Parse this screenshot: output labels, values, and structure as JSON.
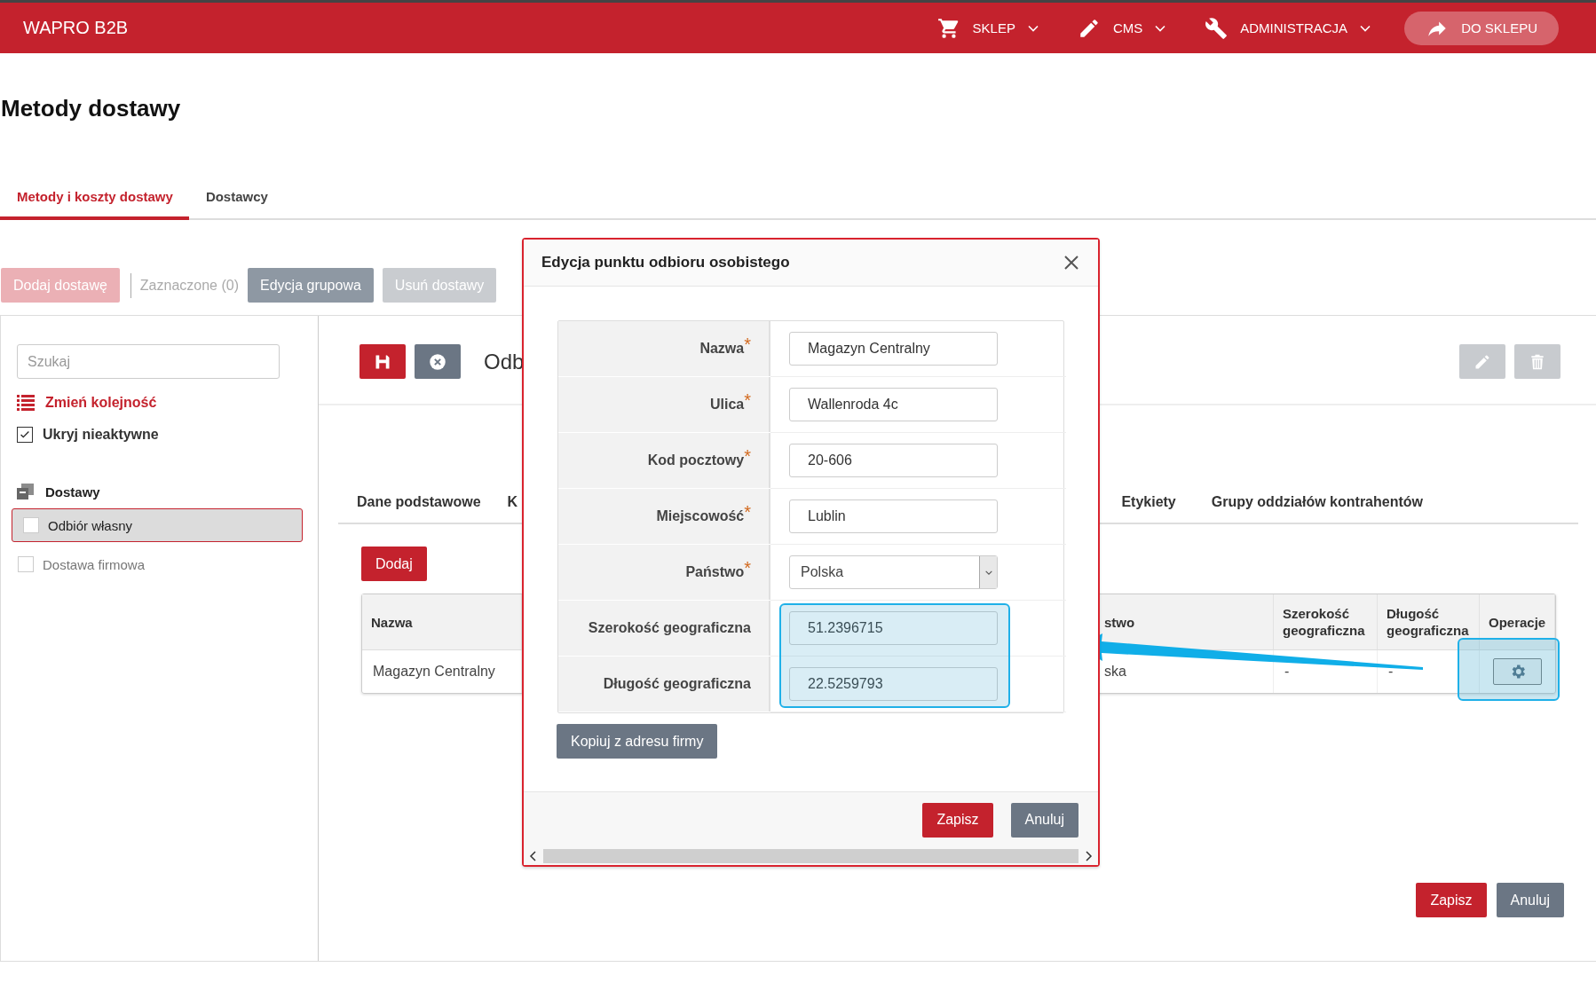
{
  "app": {
    "logo": "WAPRO B2B"
  },
  "nav": [
    {
      "label": "SKLEP",
      "kind": "cart"
    },
    {
      "label": "CMS",
      "kind": "pencil"
    },
    {
      "label": "ADMINISTRACJA",
      "kind": "wrench"
    }
  ],
  "shop_button": {
    "label": "DO SKLEPU"
  },
  "page_title": "Metody dostawy",
  "tabs": [
    {
      "label": "Metody i koszty dostawy",
      "selected": true
    },
    {
      "label": "Dostawcy",
      "selected": false
    }
  ],
  "toolbar": {
    "add_button": {
      "label": "Dodaj dostawę",
      "disabled": true
    },
    "selection_label": "Zaznaczone (0)",
    "buttons": [
      {
        "label": "Edycja grupowa",
        "disabled": false
      },
      {
        "label": "Usuń dostawy",
        "disabled": true
      }
    ]
  },
  "sidebar": {
    "search": {
      "placeholder": "Szukaj"
    },
    "reorder_link": "Zmień kolejność",
    "hide_inactive": {
      "label": "Ukryj nieaktywne",
      "checked": true
    },
    "group": "Dostawy",
    "items": [
      {
        "label": "Odbiór własny",
        "selected": true,
        "checked": false
      },
      {
        "label": "Dostawa firmowa",
        "selected": false,
        "checked": false
      }
    ]
  },
  "detail": {
    "title": "Odb",
    "subtabs": [
      {
        "label": "Dane podstawowe",
        "selected": false
      },
      {
        "label": "K",
        "selected": false
      },
      {
        "label": "Etykiety",
        "selected": false
      },
      {
        "label": "Grupy oddziałów kontrahentów",
        "selected": false
      }
    ],
    "add_button": "Dodaj",
    "table": {
      "columns": [
        "Nazwa",
        "stwo",
        "Szerokość geograficzna",
        "Długość geograficzna",
        "Operacje"
      ],
      "rows": [
        {
          "cells": [
            "Magazyn Centralny",
            "ska",
            "-",
            "-"
          ]
        }
      ]
    },
    "buttons": [
      "Zapisz",
      "Anuluj"
    ]
  },
  "modal": {
    "title": "Edycja punktu odbioru osobistego",
    "fields": [
      {
        "label": "Nazwa",
        "mark": "*",
        "kind": "text",
        "value": "Magazyn Centralny"
      },
      {
        "label": "Ulica",
        "mark": "*",
        "kind": "text",
        "value": "Wallenroda 4c"
      },
      {
        "label": "Kod pocztowy",
        "mark": "*",
        "kind": "text",
        "value": "20-606"
      },
      {
        "label": "Miejscowość",
        "mark": "*",
        "kind": "text",
        "value": "Lublin"
      },
      {
        "label": "Państwo",
        "mark": "*",
        "kind": "select",
        "value": "Polska"
      },
      {
        "label": "Szerokość geograficzna",
        "kind": "text",
        "value": "51.2396715"
      },
      {
        "label": "Długość geograficzna",
        "kind": "text",
        "value": "22.5259793"
      }
    ],
    "copy_button": "Kopiuj z adresu firmy",
    "buttons": [
      "Zapisz",
      "Anuluj"
    ]
  }
}
